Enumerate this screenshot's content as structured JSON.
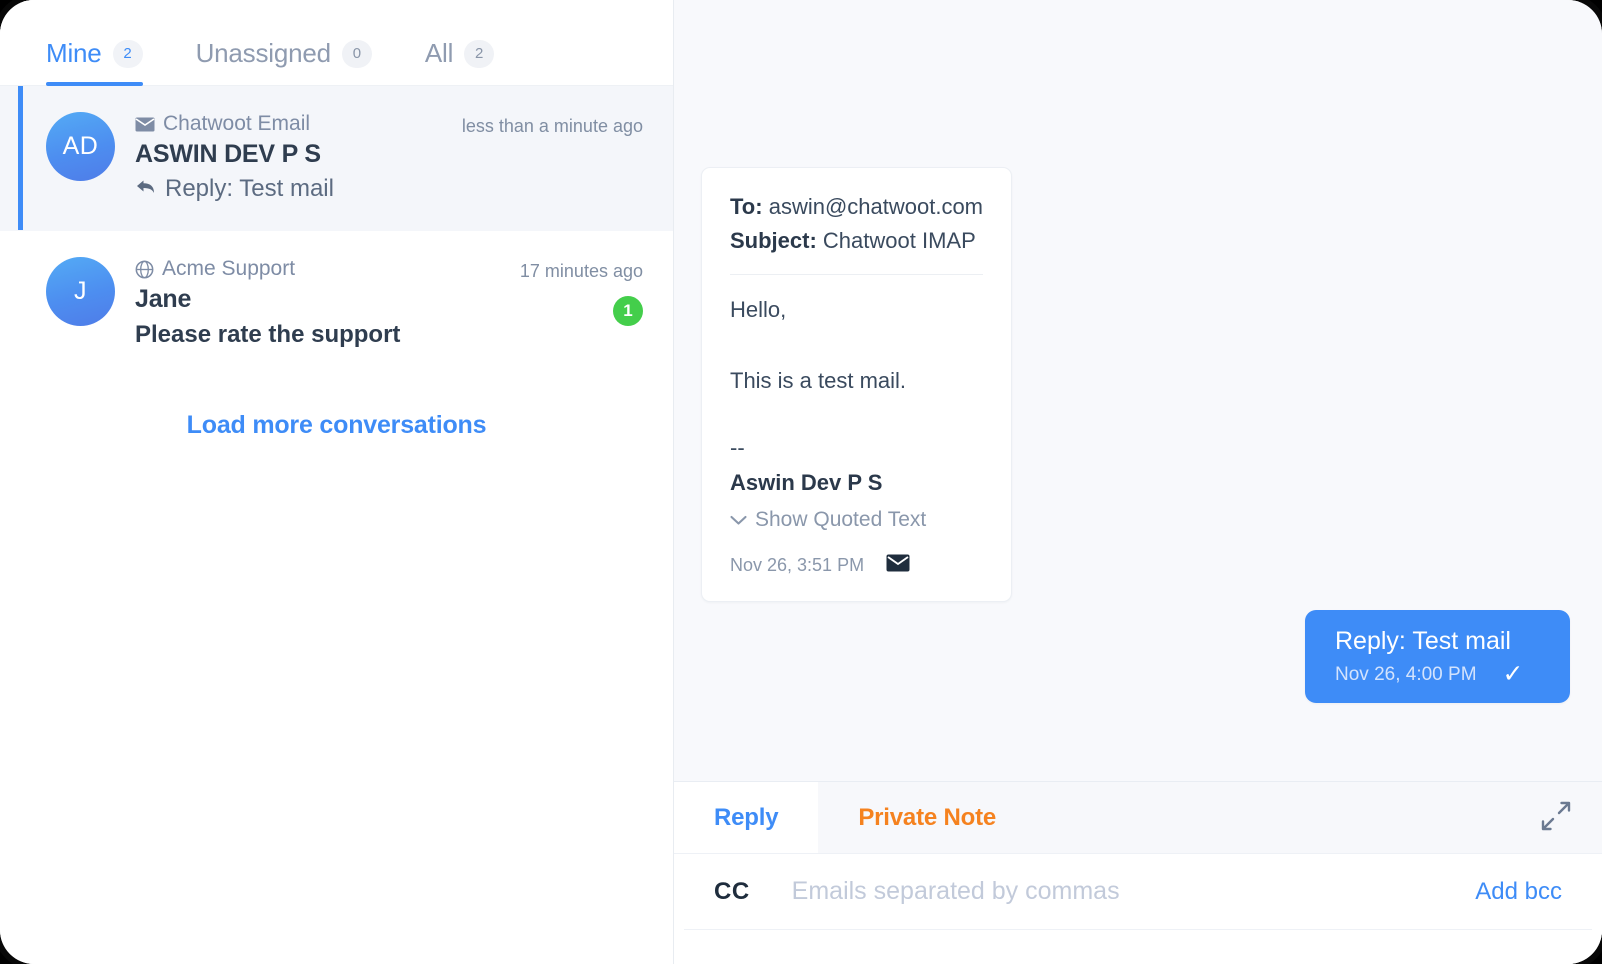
{
  "sidebar": {
    "tabs": [
      {
        "label": "Mine",
        "count": "2",
        "active": true
      },
      {
        "label": "Unassigned",
        "count": "0",
        "active": false
      },
      {
        "label": "All",
        "count": "2",
        "active": false
      }
    ],
    "conversations": [
      {
        "avatar_initials": "AD",
        "channel": "Chatwoot Email",
        "channel_icon": "envelope-icon",
        "name": "ASWIN DEV P S",
        "preview": "Reply: Test mail",
        "preview_icon": "reply-arrow-icon",
        "time": "less than a minute ago",
        "unread": "",
        "active": true
      },
      {
        "avatar_initials": "J",
        "channel": "Acme Support",
        "channel_icon": "globe-icon",
        "name": "Jane",
        "preview": "Please rate the support",
        "preview_icon": "",
        "time": "17 minutes ago",
        "unread": "1",
        "active": false
      }
    ],
    "load_more_label": "Load more conversations"
  },
  "message_panel": {
    "email": {
      "to_label": "To:",
      "to_value": "aswin@chatwoot.com",
      "subject_label": "Subject:",
      "subject_value": "Chatwoot IMAP",
      "greeting": "Hello,",
      "body": "This is a test mail.",
      "signature_dashes": "--",
      "signature_name": "Aswin Dev P S",
      "show_quoted_label": "Show Quoted Text",
      "timestamp": "Nov 26, 3:51 PM",
      "channel_icon": "envelope-icon"
    },
    "outgoing": {
      "text": "Reply: Test mail",
      "timestamp": "Nov 26, 4:00 PM",
      "status_icon": "check-icon"
    },
    "annotation": {
      "color": "#e01b1b",
      "shape": "circle-with-arrow",
      "target": "message-sent-check-icon"
    }
  },
  "reply_box": {
    "tabs": [
      {
        "label": "Reply",
        "active": true
      },
      {
        "label": "Private Note",
        "active": false
      }
    ],
    "expand_icon": "expand-diagonal-icon",
    "cc_label": "CC",
    "cc_value": "",
    "cc_placeholder": "Emails separated by commas",
    "add_bcc_label": "Add bcc"
  },
  "colors": {
    "accent_blue": "#3e8cf7",
    "note_orange": "#f5821f",
    "unread_green": "#44ce4b",
    "annotation_red": "#e01b1b",
    "panel_bg": "#f8f9fc"
  }
}
